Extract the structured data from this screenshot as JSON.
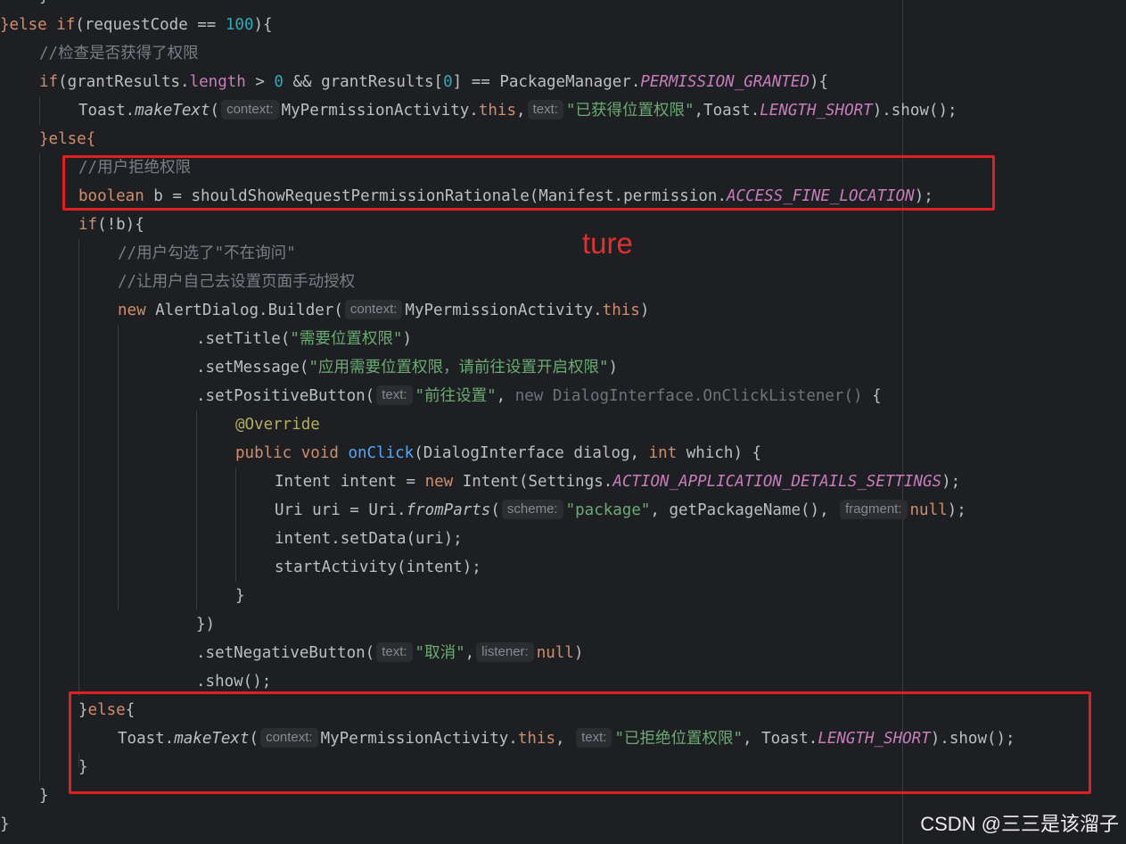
{
  "code": {
    "l0": "}",
    "l1_a": "}else if",
    "l1_b": "(requestCode == ",
    "l1_num": "100",
    "l1_c": "){",
    "l2": "//检查是否获得了权限",
    "l3_a": "if",
    "l3_b": "(grantResults.",
    "l3_len": "length",
    "l3_c": " > ",
    "l3_n0": "0",
    "l3_d": " && grantResults[",
    "l3_n1": "0",
    "l3_e": "] == PackageManager.",
    "l3_const": "PERMISSION_GRANTED",
    "l3_f": "){",
    "l4_a": "Toast.",
    "l4_m": "makeText",
    "l4_b": "(",
    "l4_h1": "context:",
    "l4_c": "MyPermissionActivity.",
    "l4_this": "this",
    "l4_d": ",",
    "l4_h2": "text:",
    "l4_str": "\"已获得位置权限\"",
    "l4_e": ",Toast.",
    "l4_const": "LENGTH_SHORT",
    "l4_f": ").show();",
    "l5": "}else{",
    "l6": "//用户拒绝权限",
    "l7_kw": "boolean",
    "l7_a": " b = shouldShowRequestPermissionRationale(Manifest.permission.",
    "l7_const": "ACCESS_FINE_LOCATION",
    "l7_b": ");",
    "l8_kw": "if",
    "l8_a": "(!b){",
    "l9": "//用户勾选了\"不在询问\"",
    "l10": "//让用户自己去设置页面手动授权",
    "l11_kw": "new",
    "l11_a": " AlertDialog.Builder(",
    "l11_h": "context:",
    "l11_b": "MyPermissionActivity.",
    "l11_this": "this",
    "l11_c": ")",
    "l12_a": ".setTitle(",
    "l12_str": "\"需要位置权限\"",
    "l12_b": ")",
    "l13_a": ".setMessage(",
    "l13_str": "\"应用需要位置权限，请前往设置开启权限\"",
    "l13_b": ")",
    "l14_a": ".setPositiveButton(",
    "l14_h": "text:",
    "l14_str": "\"前往设置\"",
    "l14_b": ", ",
    "l14_dim": "new DialogInterface.OnClickListener()",
    "l14_c": " {",
    "l15": "@Override",
    "l16_kw": "public void",
    "l16_fn": "onClick",
    "l16_a": "(DialogInterface dialog, ",
    "l16_kw2": "int",
    "l16_b": " which) {",
    "l17_a": "Intent intent = ",
    "l17_kw": "new",
    "l17_b": " Intent(Settings.",
    "l17_const": "ACTION_APPLICATION_DETAILS_SETTINGS",
    "l17_c": ");",
    "l18_a": "Uri uri = Uri.",
    "l18_m": "fromParts",
    "l18_b": "(",
    "l18_h1": "scheme:",
    "l18_str": "\"package\"",
    "l18_c": ", getPackageName(), ",
    "l18_h2": "fragment:",
    "l18_null": "null",
    "l18_d": ");",
    "l19": "intent.setData(uri);",
    "l20": "startActivity(intent);",
    "l21": "}",
    "l22": "})",
    "l23_a": ".setNegativeButton(",
    "l23_h1": "text:",
    "l23_str": "\"取消\"",
    "l23_b": ",",
    "l23_h2": "listener:",
    "l23_null": "null",
    "l23_c": ")",
    "l24": ".show();",
    "l25_a": "}",
    "l25_kw": "else",
    "l25_b": "{",
    "l26_a": "Toast.",
    "l26_m": "makeText",
    "l26_b": "(",
    "l26_h1": "context:",
    "l26_c": "MyPermissionActivity.",
    "l26_this": "this",
    "l26_d": ", ",
    "l26_h2": "text:",
    "l26_str": "\"已拒绝位置权限\"",
    "l26_e": ", Toast.",
    "l26_const": "LENGTH_SHORT",
    "l26_f": ").show();",
    "l27": "}",
    "l28": "}",
    "l29": "}"
  },
  "annotation": {
    "label": "ture"
  },
  "watermark": {
    "text": "CSDN @三三是该溜子"
  },
  "colors": {
    "background": "#1e1f22",
    "keyword": "#cf8e6d",
    "string": "#6aab73",
    "comment": "#7a7e85",
    "constant": "#c77dbb",
    "number": "#2aacb8",
    "annotation": "#b3ae60",
    "method": "#56a8f5",
    "highlight_box": "#e02020"
  }
}
